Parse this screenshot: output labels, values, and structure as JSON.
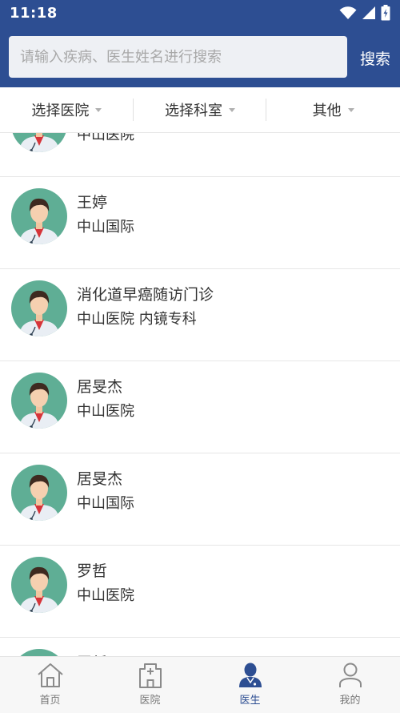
{
  "status_bar": {
    "time": "11:18"
  },
  "search": {
    "placeholder": "请输入疾病、医生姓名进行搜索",
    "button_label": "搜索"
  },
  "filters": [
    {
      "label": "选择医院"
    },
    {
      "label": "选择科室"
    },
    {
      "label": "其他"
    }
  ],
  "doctors": [
    {
      "name": "",
      "sub": "中山医院"
    },
    {
      "name": "王婷",
      "sub": "中山国际"
    },
    {
      "name": "消化道早癌随访门诊",
      "sub": "中山医院 内镜专科"
    },
    {
      "name": "居旻杰",
      "sub": "中山医院"
    },
    {
      "name": "居旻杰",
      "sub": "中山国际"
    },
    {
      "name": "罗哲",
      "sub": "中山医院"
    },
    {
      "name": "罗哲",
      "sub": ""
    }
  ],
  "tabs": [
    {
      "label": "首页",
      "icon": "home-icon",
      "active": false
    },
    {
      "label": "医院",
      "icon": "hospital-icon",
      "active": false
    },
    {
      "label": "医生",
      "icon": "doctor-icon",
      "active": true
    },
    {
      "label": "我的",
      "icon": "profile-icon",
      "active": false
    }
  ],
  "colors": {
    "primary": "#2d4e92",
    "avatar_bg": "#5fae95",
    "divider": "#e6e6e6"
  }
}
